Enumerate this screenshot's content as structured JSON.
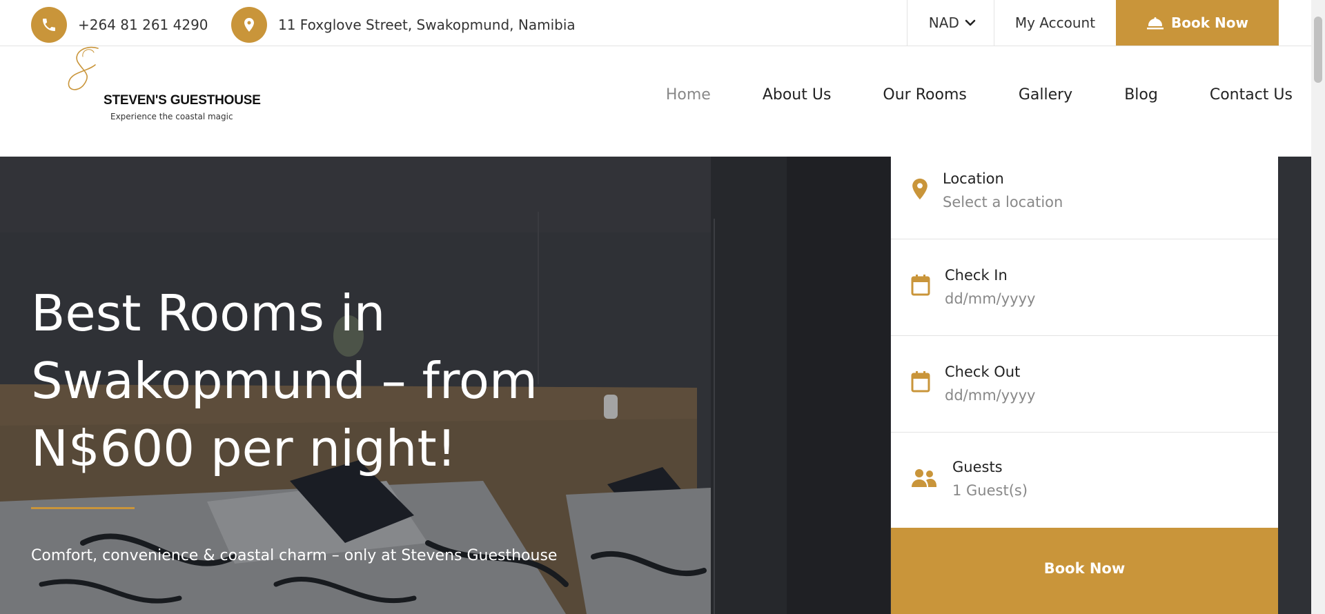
{
  "brand": {
    "accent": "#c9953a",
    "name": "STEVEN'S GUESTHOUSE",
    "tagline": "Experience the coastal magic"
  },
  "topbar": {
    "phone": "+264 81 261 4290",
    "address": "11 Foxglove Street, Swakopmund, Namibia",
    "currency": "NAD",
    "account": "My Account",
    "book_now": "Book Now"
  },
  "nav": {
    "items": [
      {
        "label": "Home",
        "active": true
      },
      {
        "label": "About Us"
      },
      {
        "label": "Our Rooms"
      },
      {
        "label": "Gallery"
      },
      {
        "label": "Blog"
      },
      {
        "label": "Contact Us"
      }
    ]
  },
  "hero": {
    "title": "Best Rooms in Swakopmund – from N$600 per night!",
    "subtitle": "Comfort, convenience & coastal charm – only at Stevens Guesthouse"
  },
  "booking": {
    "location": {
      "label": "Location",
      "value": "Select a location"
    },
    "check_in": {
      "label": "Check In",
      "value": "dd/mm/yyyy"
    },
    "check_out": {
      "label": "Check Out",
      "value": "dd/mm/yyyy"
    },
    "guests": {
      "label": "Guests",
      "value": "1 Guest(s)"
    },
    "submit": "Book Now"
  },
  "icons": {
    "phone": "phone-icon",
    "address": "map-pin-icon",
    "currency_dropdown": "chevron-down-icon",
    "book": "service-bell-icon",
    "location": "map-pin-icon",
    "calendar": "calendar-icon",
    "guests": "users-icon"
  }
}
